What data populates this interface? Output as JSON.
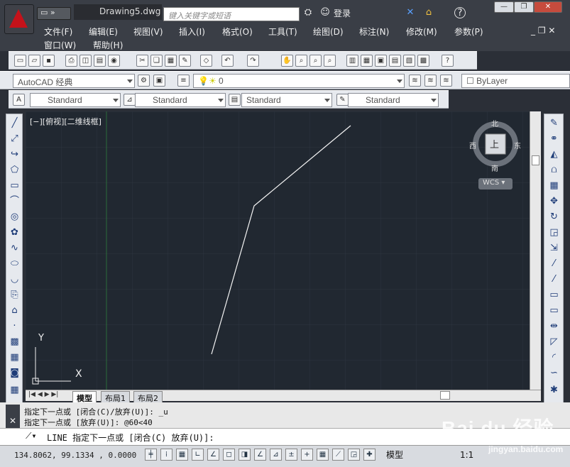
{
  "app": {
    "title": "Drawing5.dwg",
    "search_placeholder": "键入关键字或短语",
    "login": "登录",
    "help": "?"
  },
  "menus": [
    "文件(F)",
    "编辑(E)",
    "视图(V)",
    "插入(I)",
    "格式(O)",
    "工具(T)",
    "绘图(D)",
    "标注(N)",
    "修改(M)",
    "参数(P)"
  ],
  "menus2": [
    "窗口(W)",
    "帮助(H)"
  ],
  "workspace": "AutoCAD 经典",
  "layer": "0",
  "color": "ByLayer",
  "styles": [
    "Standard",
    "Standard",
    "Standard",
    "Standard"
  ],
  "viewport_label": "[−][俯视][二维线框]",
  "viewcube": {
    "top": "上",
    "n": "北",
    "s": "南",
    "e": "东",
    "w": "西",
    "wcs": "WCS"
  },
  "ucs": {
    "x": "X",
    "y": "Y"
  },
  "tabs": [
    "模型",
    "布局1",
    "布局2"
  ],
  "command_history": [
    "指定下一点或 [闭合(C)/放弃(U)]: _u",
    "指定下一点或 [放弃(U)]: @60<40"
  ],
  "command_prompt": "LINE 指定下一点或 [闭合(C) 放弃(U)]:",
  "status": {
    "coords": "134.8062, 99.1334 , 0.0000",
    "model": "模型",
    "scale": "1:1"
  },
  "watermark": {
    "brand": "Bai du 经验",
    "url": "jingyan.baidu.com"
  }
}
